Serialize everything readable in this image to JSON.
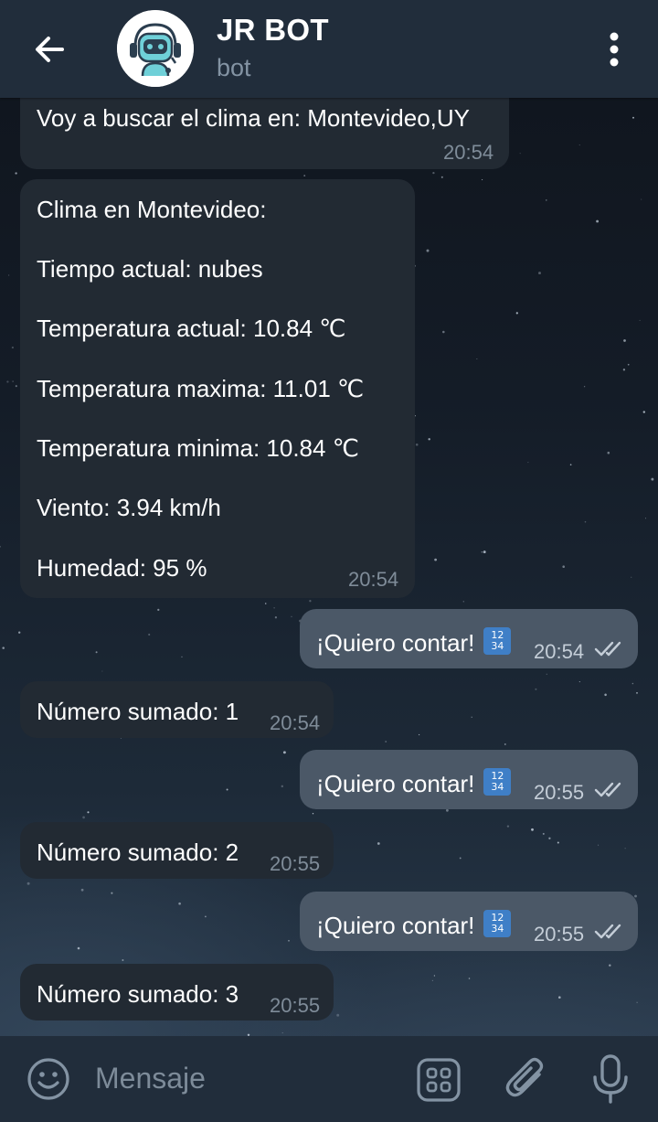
{
  "header": {
    "title": "JR BOT",
    "subtitle": "bot",
    "back_icon": "arrow-left-icon",
    "menu_icon": "more-vertical-icon",
    "avatar_icon": "robot-avatar"
  },
  "messages": [
    {
      "direction": "in",
      "lines": [
        "Voy a buscar el clima en: Montevideo,UY"
      ],
      "time": "20:54"
    },
    {
      "direction": "in",
      "lines": [
        "Clima en Montevideo:",
        "Tiempo actual: nubes",
        "Temperatura actual: 10.84 ℃",
        "Temperatura maxima: 11.01 ℃",
        "Temperatura minima: 10.84 ℃",
        "Viento: 3.94 km/h",
        "Humedad: 95 %"
      ],
      "time": "20:54"
    },
    {
      "direction": "out",
      "text": "¡Quiero contar!",
      "emoji": "input-numbers-emoji",
      "time": "20:54",
      "status": "read"
    },
    {
      "direction": "in",
      "text": "Número sumado: 1",
      "time": "20:54"
    },
    {
      "direction": "out",
      "text": "¡Quiero contar!",
      "emoji": "input-numbers-emoji",
      "time": "20:55",
      "status": "read"
    },
    {
      "direction": "in",
      "text": "Número sumado: 2",
      "time": "20:55"
    },
    {
      "direction": "out",
      "text": "¡Quiero contar!",
      "emoji": "input-numbers-emoji",
      "time": "20:55",
      "status": "read"
    },
    {
      "direction": "in",
      "text": "Número sumado: 3",
      "time": "20:55"
    }
  ],
  "emoji_digits": {
    "top": "12",
    "bottom": "34"
  },
  "composer": {
    "placeholder": "Mensaje",
    "value": "",
    "emoji_icon": "smiley-icon",
    "commands_icon": "bot-commands-icon",
    "attach_icon": "paperclip-icon",
    "mic_icon": "microphone-icon"
  },
  "colors": {
    "header_bg": "#212d3b",
    "incoming_bubble": "#222a33",
    "outgoing_bubble": "#4b5867",
    "timestamp": "#7f8c99"
  }
}
